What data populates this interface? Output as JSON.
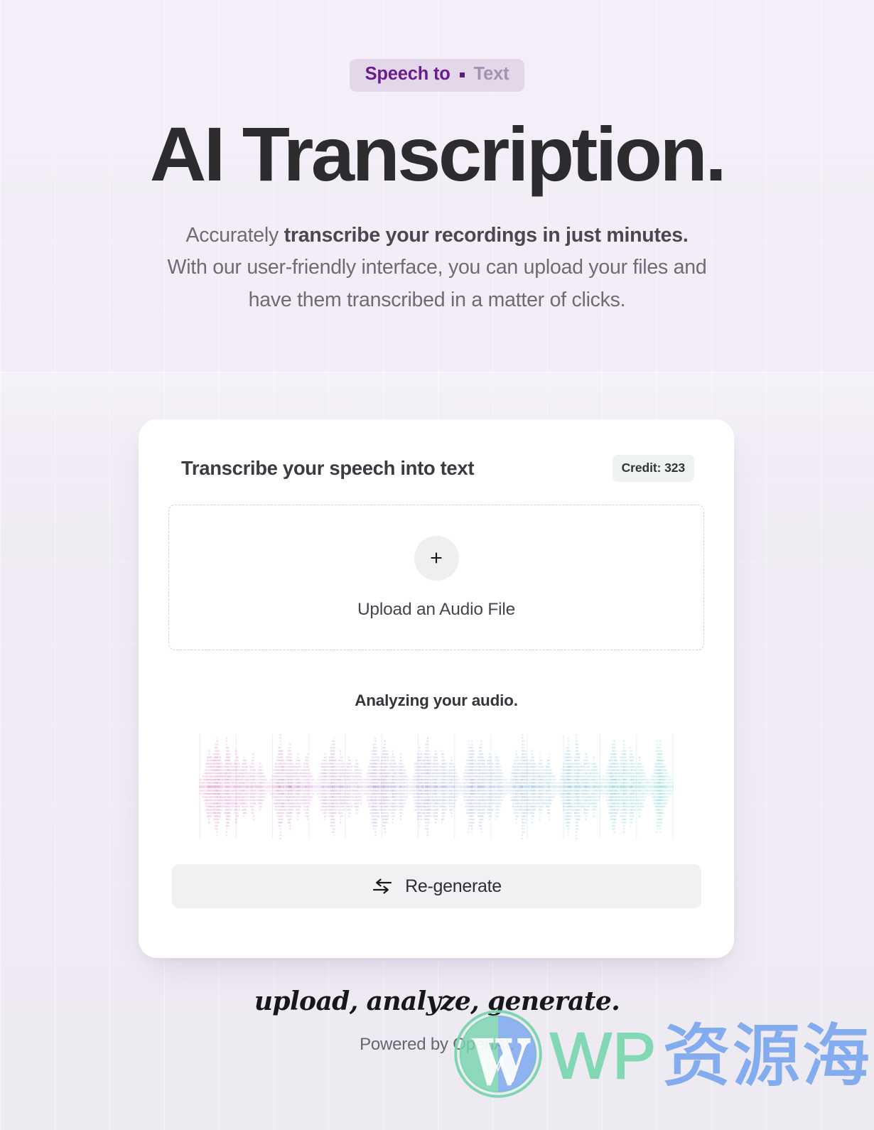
{
  "theme": {
    "background": "#f1ecf5",
    "card_bg": "#ffffff",
    "accent_purple": "#6b1d8e",
    "muted_purple": "#a393ae",
    "pill_bg": "#e2d8ea",
    "credit_bg": "#eff3ef",
    "text_dark": "#2c2c2e",
    "text_muted": "#6e6b73",
    "wave_left": "#d94fa8",
    "wave_mid": "#8a8fd8",
    "wave_right": "#3fc3c0",
    "watermark_green": "#79d6af",
    "watermark_blue": "#7aa7f0"
  },
  "hero": {
    "eyebrow_primary": "Speech to",
    "eyebrow_separator": "▪",
    "eyebrow_secondary": "Text",
    "title": "AI Transcription.",
    "subtitle_part1": "Accurately ",
    "subtitle_bold1": "transcribe your recordings in just minutes.",
    "subtitle_part2": " With our user-friendly interface, you can upload your files and have them transcribed in a matter of clicks."
  },
  "card": {
    "title": "Transcribe your speech into text",
    "credit_label": "Credit: 323",
    "dropzone": {
      "icon": "plus-icon",
      "label": "Upload an Audio File"
    },
    "status": "Analyzing your audio.",
    "regenerate": {
      "icon": "swap-arrows-icon",
      "label": "Re-generate"
    }
  },
  "footer": {
    "tagline": "upload, analyze, generate.",
    "powered_by": "Powered by OpenAI."
  },
  "watermark": {
    "icon": "wordpress-logo-icon",
    "text_latin": "WP",
    "text_cjk": "资源海"
  },
  "waveform": {
    "bar_count": 300,
    "amplitudes": [
      0.1,
      0.14,
      0.2,
      0.3,
      0.44,
      0.58,
      0.7,
      0.62,
      0.52,
      0.66,
      0.82,
      0.95,
      0.74,
      0.58,
      0.46,
      0.38,
      0.52,
      0.68,
      0.8,
      0.64,
      0.5,
      0.42,
      0.56,
      0.7,
      0.58,
      0.44,
      0.36,
      0.48,
      0.62,
      0.54,
      0.4,
      0.3,
      0.42,
      0.56,
      0.48,
      0.36,
      0.26,
      0.34,
      0.46,
      0.38,
      0.28,
      0.2,
      0.16,
      0.12,
      0.1,
      0.14,
      0.22,
      0.34,
      0.48,
      0.62,
      0.78,
      0.9,
      0.72,
      0.56,
      0.44,
      0.58,
      0.74,
      0.86,
      0.66,
      0.5,
      0.4,
      0.52,
      0.66,
      0.56,
      0.42,
      0.32,
      0.44,
      0.58,
      0.48,
      0.36,
      0.26,
      0.2,
      0.16,
      0.12,
      0.14,
      0.2,
      0.3,
      0.44,
      0.56,
      0.68,
      0.58,
      0.46,
      0.6,
      0.76,
      0.88,
      0.7,
      0.54,
      0.44,
      0.56,
      0.7,
      0.6,
      0.46,
      0.36,
      0.48,
      0.62,
      0.52,
      0.4,
      0.3,
      0.4,
      0.54,
      0.46,
      0.34,
      0.24,
      0.18,
      0.14,
      0.18,
      0.28,
      0.4,
      0.54,
      0.7,
      0.84,
      0.96,
      0.76,
      0.6,
      0.48,
      0.62,
      0.78,
      0.9,
      0.7,
      0.54,
      0.44,
      0.58,
      0.72,
      0.62,
      0.48,
      0.38,
      0.5,
      0.64,
      0.54,
      0.42,
      0.32,
      0.24,
      0.18,
      0.14,
      0.16,
      0.24,
      0.36,
      0.5,
      0.64,
      0.76,
      0.64,
      0.52,
      0.66,
      0.82,
      0.94,
      0.74,
      0.58,
      0.46,
      0.6,
      0.74,
      0.64,
      0.5,
      0.4,
      0.52,
      0.66,
      0.56,
      0.44,
      0.34,
      0.44,
      0.58,
      0.5,
      0.38,
      0.28,
      0.2,
      0.16,
      0.12,
      0.16,
      0.26,
      0.38,
      0.52,
      0.66,
      0.8,
      0.92,
      0.72,
      0.56,
      0.46,
      0.6,
      0.76,
      0.88,
      0.68,
      0.52,
      0.42,
      0.54,
      0.68,
      0.58,
      0.46,
      0.36,
      0.48,
      0.62,
      0.52,
      0.4,
      0.3,
      0.22,
      0.18,
      0.14,
      0.12,
      0.18,
      0.28,
      0.42,
      0.56,
      0.7,
      0.58,
      0.46,
      0.6,
      0.78,
      0.9,
      0.7,
      0.54,
      0.44,
      0.56,
      0.7,
      0.6,
      0.48,
      0.38,
      0.5,
      0.64,
      0.54,
      0.42,
      0.32,
      0.42,
      0.56,
      0.48,
      0.36,
      0.26,
      0.2,
      0.16,
      0.12,
      0.14,
      0.22,
      0.34,
      0.48,
      0.64,
      0.8,
      0.94,
      0.74,
      0.58,
      0.46,
      0.6,
      0.76,
      0.86,
      0.66,
      0.5,
      0.4,
      0.52,
      0.68,
      0.58,
      0.44,
      0.34,
      0.46,
      0.6,
      0.5,
      0.38,
      0.28,
      0.22,
      0.16,
      0.14,
      0.18,
      0.28,
      0.4,
      0.54,
      0.68,
      0.82,
      0.92,
      0.72,
      0.56,
      0.44,
      0.58,
      0.74,
      0.88,
      0.7,
      0.54,
      0.44,
      0.56,
      0.7,
      0.6,
      0.46,
      0.36,
      0.46,
      0.6,
      0.5,
      0.38,
      0.28,
      0.22,
      0.18,
      0.14,
      0.16,
      0.24,
      0.36,
      0.5,
      0.66,
      0.8,
      0.9,
      0.7,
      0.54,
      0.42,
      0.34,
      0.26,
      0.2,
      0.16,
      0.12
    ]
  }
}
